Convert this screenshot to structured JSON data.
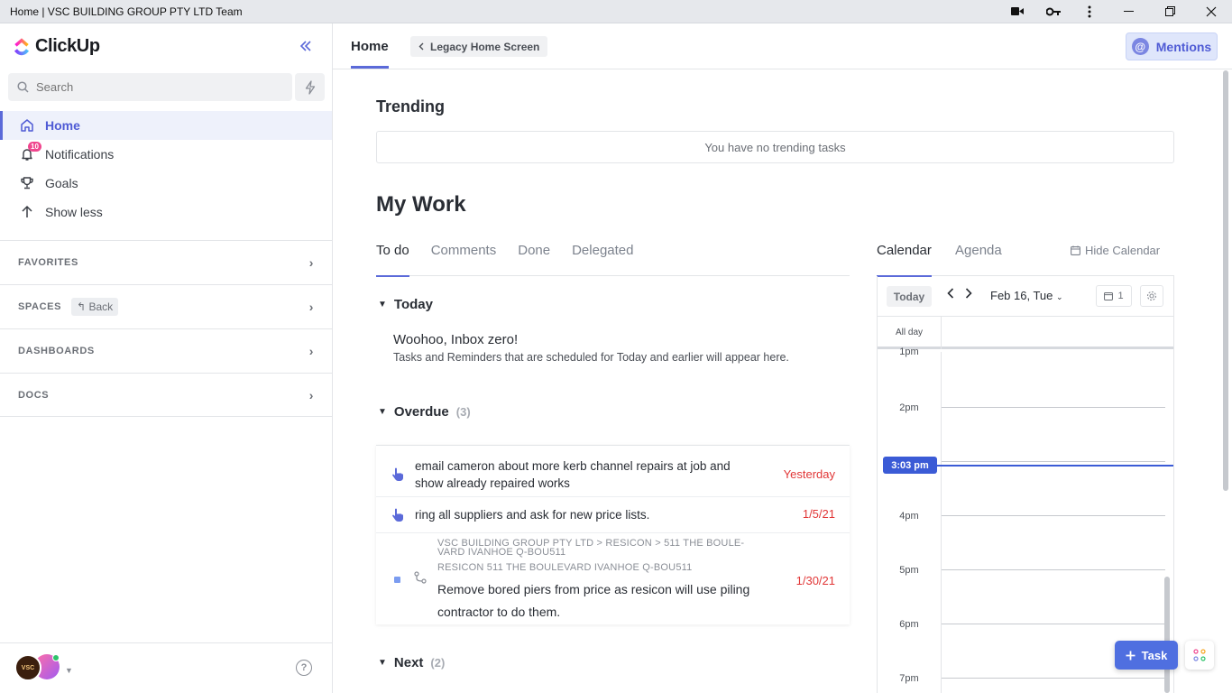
{
  "window": {
    "title": "Home | VSC BUILDING GROUP PTY LTD Team"
  },
  "brand": {
    "name": "ClickUp"
  },
  "sidebar": {
    "search_placeholder": "Search",
    "items": [
      {
        "label": "Home",
        "icon": "home-icon"
      },
      {
        "label": "Notifications",
        "icon": "bell-icon",
        "badge": "10"
      },
      {
        "label": "Goals",
        "icon": "trophy-icon"
      },
      {
        "label": "Show less",
        "icon": "arrow-up-icon"
      }
    ],
    "sections": [
      {
        "label": "FAVORITES"
      },
      {
        "label": "SPACES",
        "back_label": "Back"
      },
      {
        "label": "DASHBOARDS"
      },
      {
        "label": "DOCS"
      }
    ],
    "avatar_text": "VSC"
  },
  "topbar": {
    "home_tab": "Home",
    "legacy_label": "Legacy Home Screen",
    "mentions_label": "Mentions"
  },
  "trending": {
    "title": "Trending",
    "empty": "You have no trending tasks"
  },
  "mywork": {
    "title": "My Work",
    "tabs": [
      "To do",
      "Comments",
      "Done",
      "Delegated"
    ],
    "active_tab": "To do",
    "today": {
      "label": "Today",
      "empty_title": "Woohoo, Inbox zero!",
      "empty_sub": "Tasks and Reminders that are scheduled for Today and earlier will appear here."
    },
    "overdue": {
      "label": "Overdue",
      "count": "(3)",
      "tasks": [
        {
          "line1": "email cameron about more kerb channel repairs at job and",
          "line2": "show already repaired works",
          "date": "Yesterday"
        },
        {
          "line1": "ring all suppliers and ask for new price lists.",
          "date": "1/5/21"
        },
        {
          "crumb1": "VSC BUILDING GROUP PTY LTD   >   RESICON   >   511 THE BOULE-",
          "crumb2": "VARD IVANHOE Q-BOU511",
          "crumb3": "RESICON 511 THE BOULEVARD IVANHOE Q-BOU511",
          "line1": "Remove bored piers from price as resicon will use piling",
          "line2": "contractor to do them.",
          "date": "1/30/21",
          "status_color": "#7b9cf0"
        }
      ]
    },
    "next": {
      "label": "Next",
      "count": "(2)"
    }
  },
  "calendar": {
    "tabs": [
      "Calendar",
      "Agenda"
    ],
    "active_tab": "Calendar",
    "hide_label": "Hide Calendar",
    "today_btn": "Today",
    "date_label": "Feb 16, Tue",
    "days_count": "1",
    "allday_label": "All day",
    "hours": [
      "1pm",
      "2pm",
      "4pm",
      "5pm",
      "6pm",
      "7pm"
    ],
    "now_label": "3:03 pm"
  },
  "fab": {
    "task_label": "Task"
  },
  "colors": {
    "accent": "#5b6ad9",
    "overdue": "#e13636",
    "now": "#3b5bd6"
  }
}
